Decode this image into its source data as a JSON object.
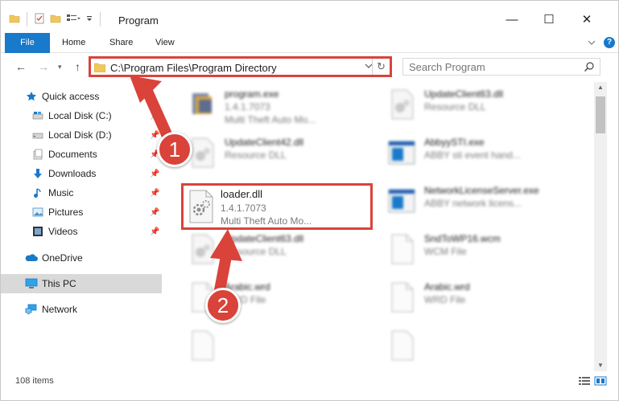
{
  "window": {
    "title": "Program",
    "controls": {
      "minimize": "—",
      "maximize": "☐",
      "close": "✕"
    }
  },
  "ribbon": {
    "tabs": [
      {
        "label": "File",
        "active": true
      },
      {
        "label": "Home"
      },
      {
        "label": "Share"
      },
      {
        "label": "View"
      }
    ],
    "expand_icon": "chevron-down-icon",
    "help_label": "?"
  },
  "navigation": {
    "address_path": "C:\\Program Files\\Program Directory",
    "search_placeholder": "Search Program"
  },
  "sidebar": {
    "items": [
      {
        "label": "Quick access",
        "icon": "star-icon",
        "pinned": false
      },
      {
        "label": "Local Disk (C:)",
        "icon": "drive-icon",
        "pinned": true
      },
      {
        "label": "Local Disk (D:)",
        "icon": "drive-icon",
        "pinned": true
      },
      {
        "label": "Documents",
        "icon": "documents-icon",
        "pinned": true
      },
      {
        "label": "Downloads",
        "icon": "download-icon",
        "pinned": true
      },
      {
        "label": "Music",
        "icon": "music-icon",
        "pinned": true
      },
      {
        "label": "Pictures",
        "icon": "pictures-icon",
        "pinned": true
      },
      {
        "label": "Videos",
        "icon": "videos-icon",
        "pinned": true
      },
      {
        "label": "OneDrive",
        "icon": "cloud-icon",
        "pinned": false
      },
      {
        "label": "This PC",
        "icon": "computer-icon",
        "pinned": false,
        "selected": true
      },
      {
        "label": "Network",
        "icon": "network-icon",
        "pinned": false
      }
    ]
  },
  "files": [
    {
      "name": "program.exe",
      "line2": "1.4.1.7073",
      "line3": "Multi Theft Auto Mo...",
      "icon": "exe-icon"
    },
    {
      "name": "UpdateClient63.dll",
      "line2": "Resource DLL",
      "line3": "",
      "icon": "dll-icon"
    },
    {
      "name": "UpdateClient42.dll",
      "line2": "Resource DLL",
      "line3": "",
      "icon": "dll-icon"
    },
    {
      "name": "AbbyySTI.exe",
      "line2": "ABBY sti event hand...",
      "line3": "",
      "icon": "app-window-icon"
    },
    {
      "name": "loader.dll",
      "line2": "1.4.1.7073",
      "line3": "Multi Theft Auto Mo...",
      "icon": "dll-icon",
      "highlighted": true
    },
    {
      "name": "NetworkLicenseServer.exe",
      "line2": "ABBY network licens...",
      "line3": "",
      "icon": "app-window-icon"
    },
    {
      "name": "UpdateClient63.dll",
      "line2": "Resource DLL",
      "line3": "",
      "icon": "dll-icon"
    },
    {
      "name": "SndToWP16.wcm",
      "line2": "WCM File",
      "line3": "",
      "icon": "blank-file-icon"
    },
    {
      "name": "Arabic.wrd",
      "line2": "WRD File",
      "line3": "",
      "icon": "blank-file-icon"
    },
    {
      "name": "Arabic.wrd",
      "line2": "WRD File",
      "line3": "",
      "icon": "blank-file-icon"
    }
  ],
  "status": {
    "item_count": "108 items"
  },
  "annotations": [
    {
      "label": "1",
      "points_to": "address bar"
    },
    {
      "label": "2",
      "points_to": "loader.dll"
    }
  ],
  "colors": {
    "accent": "#1979ca",
    "annotation": "#d9433a",
    "selected": "#d9d9d9"
  }
}
